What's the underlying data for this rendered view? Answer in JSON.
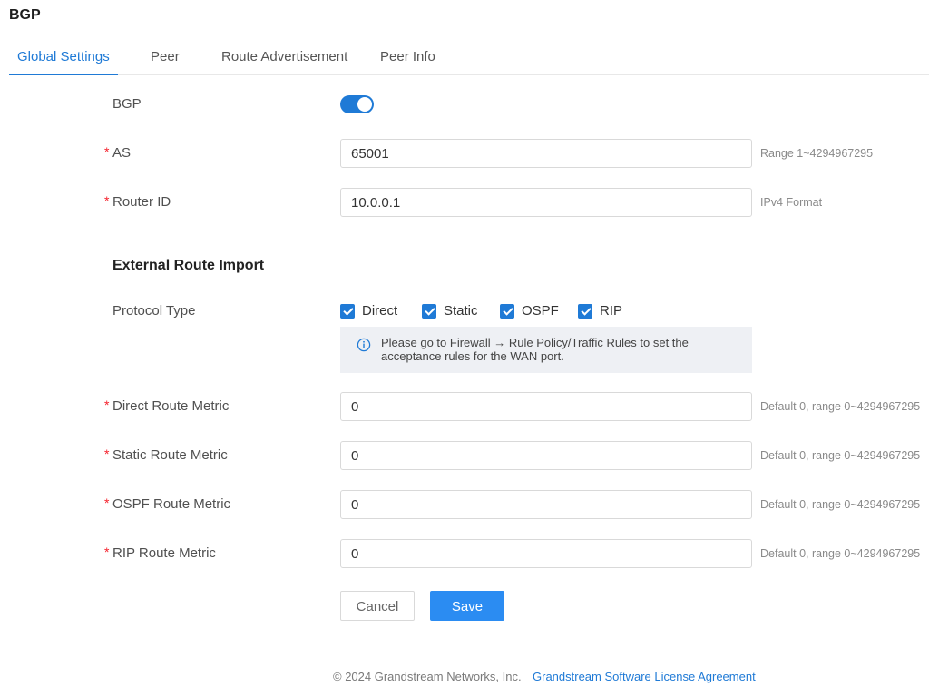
{
  "page": {
    "title": "BGP"
  },
  "tabs": [
    {
      "label": "Global Settings",
      "active": true
    },
    {
      "label": "Peer",
      "active": false
    },
    {
      "label": "Route Advertisement",
      "active": false
    },
    {
      "label": "Peer Info",
      "active": false
    }
  ],
  "form": {
    "required_mark": "*",
    "bgp": {
      "label": "BGP",
      "enabled": true
    },
    "as": {
      "label": "AS",
      "required": true,
      "value": "65001",
      "hint": "Range 1~4294967295"
    },
    "router_id": {
      "label": "Router ID",
      "required": true,
      "value": "10.0.0.1",
      "hint": "IPv4 Format"
    },
    "section_title": "External Route Import",
    "protocol_type": {
      "label": "Protocol Type",
      "options": [
        {
          "label": "Direct",
          "checked": true
        },
        {
          "label": "Static",
          "checked": true
        },
        {
          "label": "OSPF",
          "checked": true
        },
        {
          "label": "RIP",
          "checked": true
        }
      ]
    },
    "notice": {
      "icon": "info-icon",
      "lines": [
        "Please go to Firewall → Rule Policy/Traffic Rules to set the",
        "acceptance rules for the WAN port."
      ]
    },
    "metrics": [
      {
        "label": "Direct Route Metric",
        "required": true,
        "value": "0",
        "hint": "Default 0, range 0~4294967295"
      },
      {
        "label": "Static Route Metric",
        "required": true,
        "value": "0",
        "hint": "Default 0, range 0~4294967295"
      },
      {
        "label": "OSPF Route Metric",
        "required": true,
        "value": "0",
        "hint": "Default 0, range 0~4294967295"
      },
      {
        "label": "RIP Route Metric",
        "required": true,
        "value": "0",
        "hint": "Default 0, range 0~4294967295"
      }
    ]
  },
  "actions": {
    "cancel_label": "Cancel",
    "save_label": "Save"
  },
  "footer": {
    "copyright": "© 2024 Grandstream Networks, Inc.",
    "license_link": "Grandstream Software License Agreement"
  },
  "colors": {
    "primary": "#1f7ad6",
    "save": "#2b8cf2",
    "required": "#f5222d",
    "notice-bg": "#eef0f4"
  }
}
